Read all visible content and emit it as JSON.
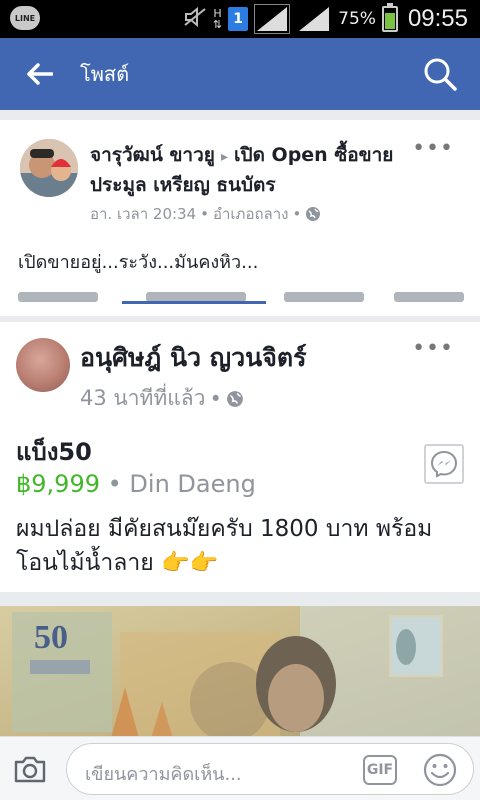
{
  "status_bar": {
    "line_label": "LINE",
    "ht_label": "H",
    "sim_label": "1",
    "battery_pct": "75%",
    "battery_level": 0.75,
    "time": "09:55"
  },
  "header": {
    "title": "โพสต์",
    "back_icon": "arrow-left-icon",
    "search_icon": "search-icon",
    "bg_color": "#4267b2"
  },
  "post1": {
    "author": "จารุวัฒน์ ขาวยู",
    "arrow": "▸",
    "group": "เปิด Open ซื้อขาย",
    "group_line2": "ประมูล เหรียญ ธนบัตร",
    "time": "อา. เวลา 20:34",
    "separator": "•",
    "location": "อำเภอถลาง",
    "separator2": "•",
    "text": "เปิดขายอยู่...ระวัง...มันคงหิว...",
    "more_label": "•••"
  },
  "post2": {
    "author": "อนุศิษฎ์ นิว ญวนจิตร์",
    "time": "43 นาทีที่แล้ว",
    "separator": "•",
    "item_title": "แบ็ง50",
    "price": "฿9,999",
    "location_sep": "•",
    "location": "Din Daeng",
    "description": "ผมปล่อย มีคัยสนม๊ยครับ  1800 บาท พร้อมโอนไม้น้ำลาย 👉👉",
    "more_label": "•••",
    "price_color": "#42b72a",
    "banknote_value": "50"
  },
  "composer": {
    "placeholder": "เขียนความคิดเห็น...",
    "gif_label": "GIF",
    "camera_icon": "camera-icon",
    "emoji_icon": "smiley-icon"
  }
}
